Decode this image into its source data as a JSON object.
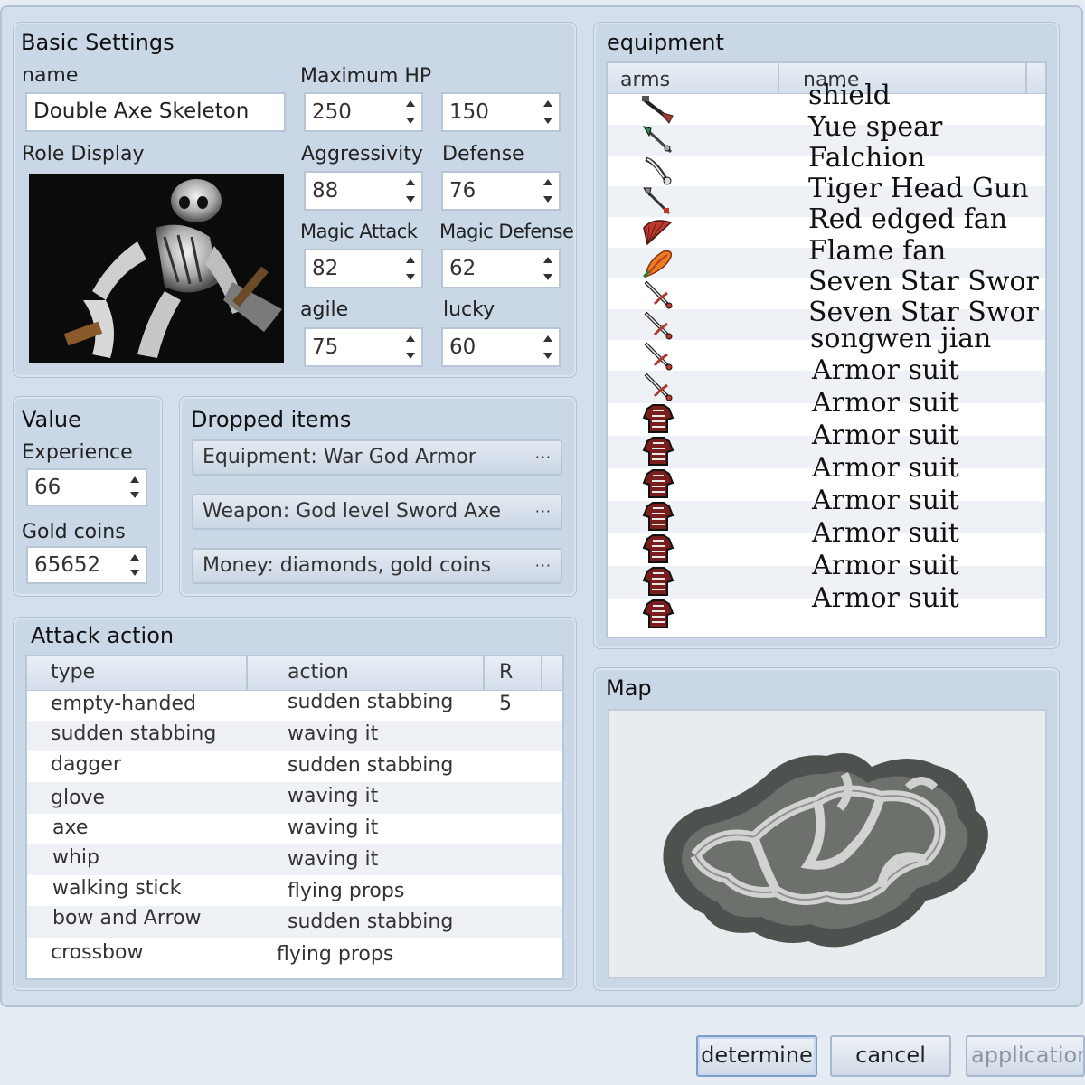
{
  "basic_settings": {
    "title": "Basic Settings",
    "name_label": "name",
    "name_value": "Double Axe Skeleton",
    "role_display_label": "Role Display",
    "max_hp_label": "Maximum  HP",
    "max_value": "250",
    "hp_value": "150",
    "aggressivity_label": "Aggressivity",
    "aggressivity_value": "88",
    "defense_label": "Defense",
    "defense_value": "76",
    "magic_attack_label": "Magic Attack",
    "magic_attack_value": "82",
    "magic_defense_label": "Magic Defense",
    "magic_defense_value": "62",
    "agile_label": "agile",
    "agile_value": "75",
    "lucky_label": "lucky",
    "lucky_value": "60"
  },
  "value_panel": {
    "title": "Value",
    "experience_label": "Experience",
    "experience_value": "66",
    "gold_label": "Gold coins",
    "gold_value": "65652"
  },
  "dropped_items": {
    "title": "Dropped items",
    "items": [
      "Equipment: War God Armor",
      "Weapon: God level Sword Axe",
      "Money: diamonds, gold coins"
    ],
    "more_label": "···"
  },
  "attack_action": {
    "title": "Attack action",
    "columns": [
      "type",
      "action",
      "R"
    ],
    "rows": [
      {
        "type": "empty-handed",
        "action": "sudden stabbing",
        "r": "5"
      },
      {
        "type": "sudden stabbing",
        "action": "waving it",
        "r": ""
      },
      {
        "type": "dagger",
        "action": "sudden stabbing",
        "r": ""
      },
      {
        "type": "glove",
        "action": "waving it",
        "r": ""
      },
      {
        "type": "axe",
        "action": "waving it",
        "r": ""
      },
      {
        "type": "whip",
        "action": "waving it",
        "r": ""
      },
      {
        "type": "walking stick",
        "action": "flying props",
        "r": ""
      },
      {
        "type": "bow and Arrow",
        "action": "sudden stabbing",
        "r": ""
      },
      {
        "type": "crossbow",
        "action": "flying props",
        "r": ""
      }
    ]
  },
  "equipment": {
    "title": "equipment",
    "columns": [
      "arms",
      "name"
    ],
    "rows": [
      {
        "icon": "shield-icon",
        "name": "shield"
      },
      {
        "icon": "spear-icon",
        "name": "Yue spear"
      },
      {
        "icon": "falchion-icon",
        "name": "Falchion"
      },
      {
        "icon": "gun-icon",
        "name": "Tiger Head Gun"
      },
      {
        "icon": "fan-icon",
        "name": "Red edged fan"
      },
      {
        "icon": "flame-fan-icon",
        "name": "Flame fan"
      },
      {
        "icon": "sword-icon",
        "name": "Seven Star Swor"
      },
      {
        "icon": "sword-icon",
        "name": "Seven Star Swor"
      },
      {
        "icon": "sword-icon",
        "name": "songwen jian"
      },
      {
        "icon": "sword-icon",
        "name": "Armor suit"
      },
      {
        "icon": "armor-icon",
        "name": "Armor suit"
      },
      {
        "icon": "armor-icon",
        "name": "Armor suit"
      },
      {
        "icon": "armor-icon",
        "name": "Armor suit"
      },
      {
        "icon": "armor-icon",
        "name": "Armor suit"
      },
      {
        "icon": "armor-icon",
        "name": "Armor suit"
      },
      {
        "icon": "armor-icon",
        "name": "Armor suit"
      },
      {
        "icon": "armor-icon",
        "name": "Armor suit"
      }
    ]
  },
  "map_panel": {
    "title": "Map"
  },
  "footer": {
    "determine_label": "determine",
    "cancel_label": "cancel",
    "application_label": "application"
  }
}
